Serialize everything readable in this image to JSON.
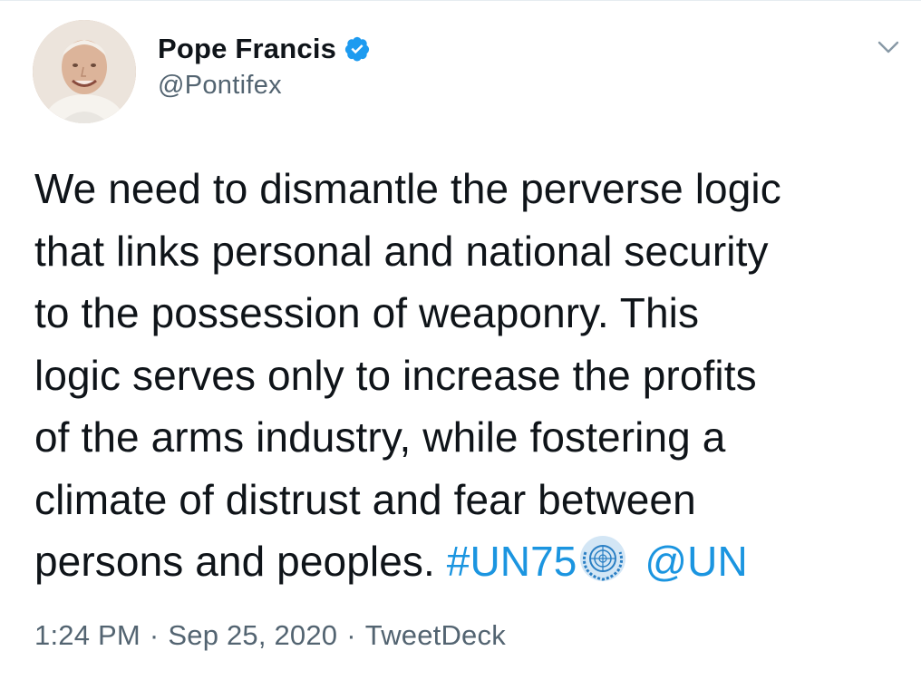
{
  "author": {
    "display_name": "Pope Francis",
    "handle": "@Pontifex",
    "verified": true
  },
  "tweet": {
    "text_segments": [
      "We need to dismantle the perverse logic",
      "that links personal and national security",
      "to the possession of weaponry. This",
      "logic serves only to increase the profits",
      "of the arms industry, while fostering a",
      "climate of distrust and fear between",
      "persons and peoples."
    ],
    "hashtag": "#UN75",
    "mention": "@UN"
  },
  "meta": {
    "time": "1:24 PM",
    "separator": "·",
    "date": "Sep 25, 2020",
    "source": "TweetDeck"
  },
  "colors": {
    "link": "#1b95e0",
    "secondary_text": "#536471",
    "primary_text": "#0f1419",
    "verified_badge": "#1d9bf0"
  },
  "icons": {
    "verified": "verified-badge-icon",
    "caret": "chevron-down-icon",
    "emblem": "un-emblem-icon"
  }
}
